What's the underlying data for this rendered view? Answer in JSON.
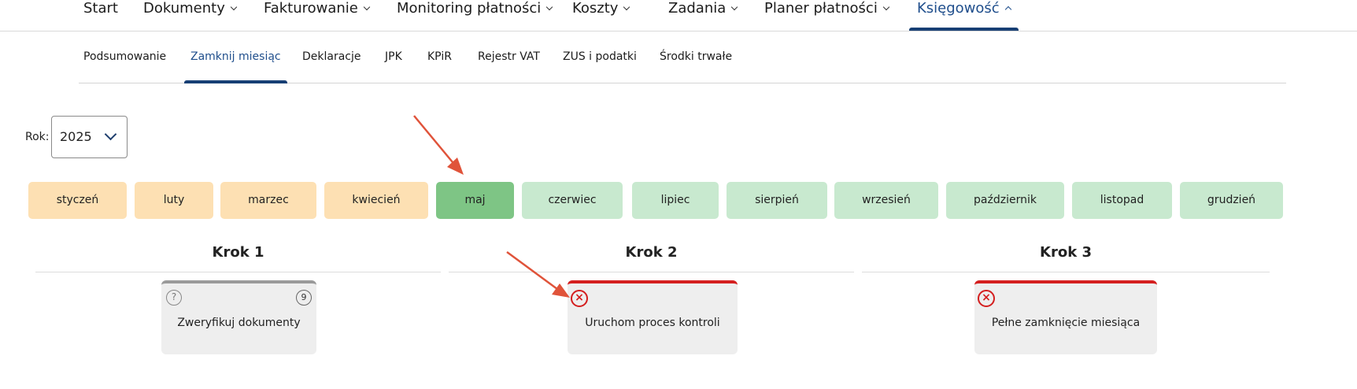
{
  "topnav": {
    "items": [
      {
        "label": "Start",
        "has_dropdown": false
      },
      {
        "label": "Dokumenty",
        "has_dropdown": true
      },
      {
        "label": "Fakturowanie",
        "has_dropdown": true
      },
      {
        "label": "Monitoring płatności",
        "has_dropdown": true
      },
      {
        "label": "Koszty",
        "has_dropdown": true
      },
      {
        "label": "Zadania",
        "has_dropdown": true
      },
      {
        "label": "Planer płatności",
        "has_dropdown": true
      },
      {
        "label": "Księgowość",
        "has_dropdown": true,
        "active": true
      }
    ]
  },
  "subnav": {
    "items": [
      {
        "label": "Podsumowanie"
      },
      {
        "label": "Zamknij miesiąc",
        "active": true
      },
      {
        "label": "Deklaracje"
      },
      {
        "label": "JPK"
      },
      {
        "label": "KPiR"
      },
      {
        "label": "Rejestr VAT"
      },
      {
        "label": "ZUS i podatki"
      },
      {
        "label": "Środki trwałe"
      }
    ]
  },
  "year": {
    "label": "Rok:",
    "value": "2025"
  },
  "months": [
    {
      "label": "styczeń",
      "status": "closed"
    },
    {
      "label": "luty",
      "status": "closed"
    },
    {
      "label": "marzec",
      "status": "closed"
    },
    {
      "label": "kwiecień",
      "status": "closed"
    },
    {
      "label": "maj",
      "status": "selected"
    },
    {
      "label": "czerwiec",
      "status": "open"
    },
    {
      "label": "lipiec",
      "status": "open"
    },
    {
      "label": "sierpień",
      "status": "open"
    },
    {
      "label": "wrzesień",
      "status": "open"
    },
    {
      "label": "październik",
      "status": "open"
    },
    {
      "label": "listopad",
      "status": "open"
    },
    {
      "label": "grudzień",
      "status": "open"
    }
  ],
  "steps": [
    {
      "title": "Krok 1",
      "card": {
        "label": "Zweryfikuj dokumenty",
        "status": "pending",
        "status_icon": "question-icon",
        "count": "9"
      }
    },
    {
      "title": "Krok 2",
      "card": {
        "label": "Uruchom proces kontroli",
        "status": "error",
        "status_icon": "error-x-icon"
      }
    },
    {
      "title": "Krok 3",
      "card": {
        "label": "Pełne zamknięcie miesiąca",
        "status": "error",
        "status_icon": "error-x-icon"
      }
    }
  ],
  "colors": {
    "accent": "#1f4e8c",
    "month_closed": "#fde0b3",
    "month_open": "#c8e9cf",
    "month_selected": "#7ec585",
    "error": "#d41f1f",
    "annotation_arrow": "#e0533a"
  }
}
